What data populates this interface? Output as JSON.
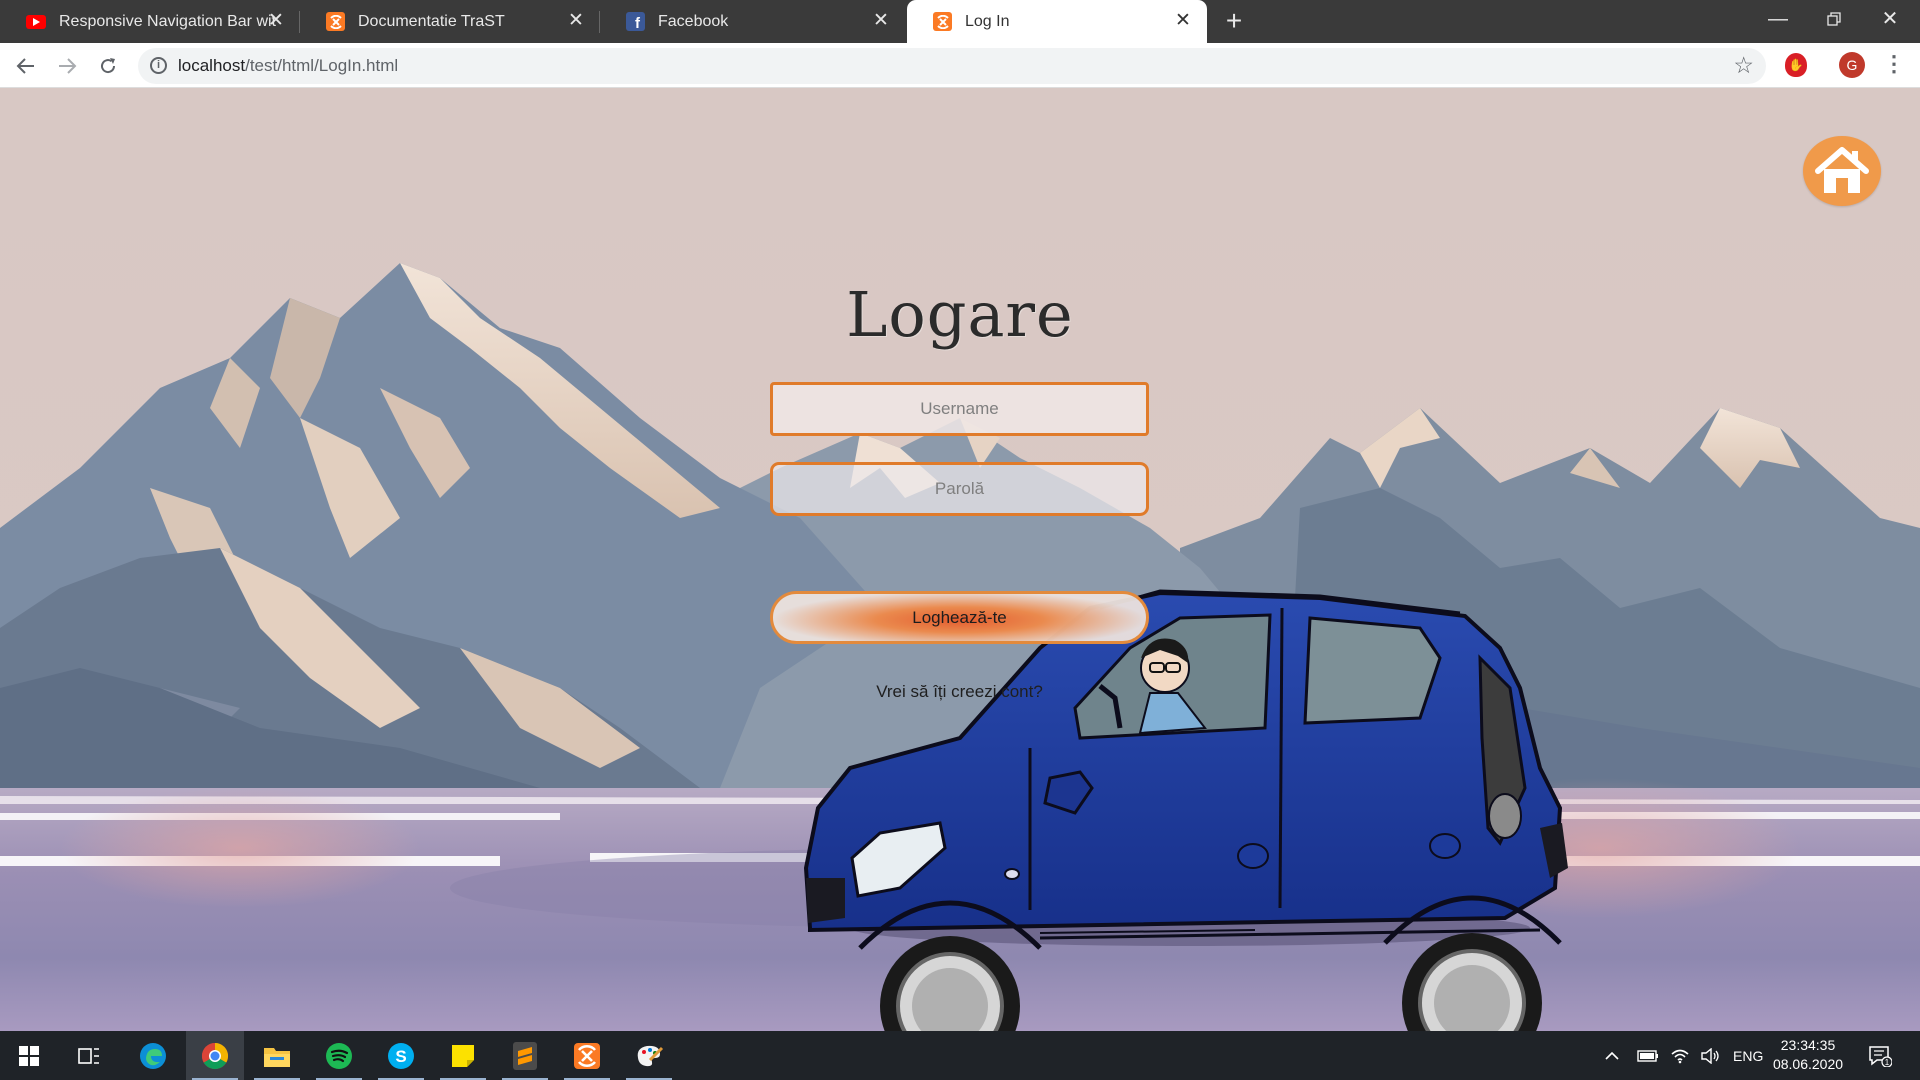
{
  "browser": {
    "tabs": [
      {
        "title": "Responsive Navigation Bar with I",
        "favicon": "youtube-icon",
        "active": false
      },
      {
        "title": "Documentatie TraST",
        "favicon": "xampp-icon",
        "active": false
      },
      {
        "title": "Facebook",
        "favicon": "facebook-icon",
        "active": false
      },
      {
        "title": "Log In",
        "favicon": "xampp-icon",
        "active": true
      }
    ],
    "new_tab_label": "+",
    "url_host": "localhost",
    "url_path": "/test/html/LogIn.html",
    "avatar_initial": "G"
  },
  "page": {
    "heading": "Logare",
    "username_placeholder": "Username",
    "password_placeholder": "Parolă",
    "login_button": "Loghează-te",
    "signup_link": "Vrei să îți creezi cont?"
  },
  "taskbar": {
    "apps": [
      "windows-start-icon",
      "task-view-icon",
      "edge-icon",
      "chrome-icon",
      "file-explorer-icon",
      "spotify-icon",
      "skype-icon",
      "sticky-notes-icon",
      "sublime-text-icon",
      "xampp-icon",
      "paint-icon"
    ],
    "language": "ENG",
    "time": "23:34:35",
    "date": "08.06.2020",
    "notification_count": "1"
  },
  "colors": {
    "accent_orange": "#e07b2a",
    "home_button": "#f09a4a",
    "car_blue": "#1f3c9c",
    "tabstrip": "#3a3a3a",
    "taskbar": "#1f2328"
  }
}
